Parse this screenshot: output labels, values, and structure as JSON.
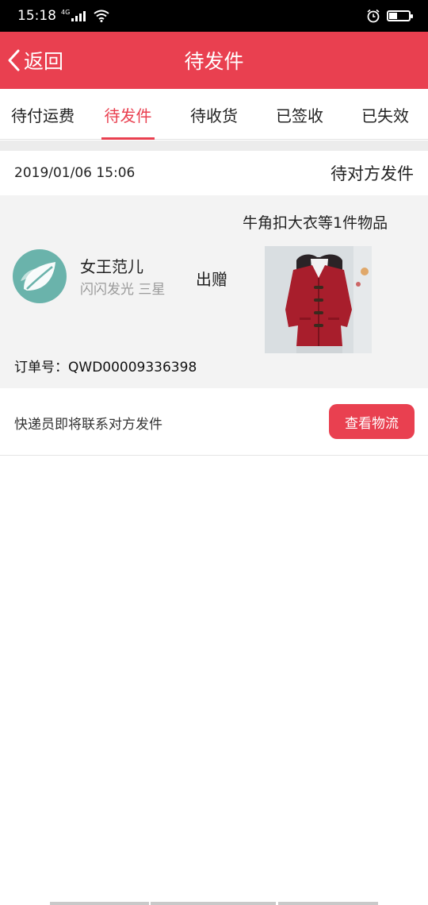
{
  "status_bar": {
    "time": "15:18",
    "network": "4G"
  },
  "nav": {
    "back_label": "返回",
    "title": "待发件"
  },
  "tabs": [
    {
      "label": "待付运费",
      "active": false
    },
    {
      "label": "待发件",
      "active": true
    },
    {
      "label": "待收货",
      "active": false
    },
    {
      "label": "已签收",
      "active": false
    },
    {
      "label": "已失效",
      "active": false
    }
  ],
  "order": {
    "date": "2019/01/06 15:06",
    "status": "待对方发件",
    "user_name": "女王范儿",
    "user_sub": "闪闪发光 三星",
    "action": "出赠",
    "item_title": "牛角扣大衣等1件物品",
    "order_no": "订单号：QWD00009336398",
    "note": "快递员即将联系对方发件",
    "button_label": "查看物流"
  },
  "colors": {
    "accent": "#e94050",
    "avatar_bg": "#6ab3ab",
    "coat": "#a81e2c"
  }
}
